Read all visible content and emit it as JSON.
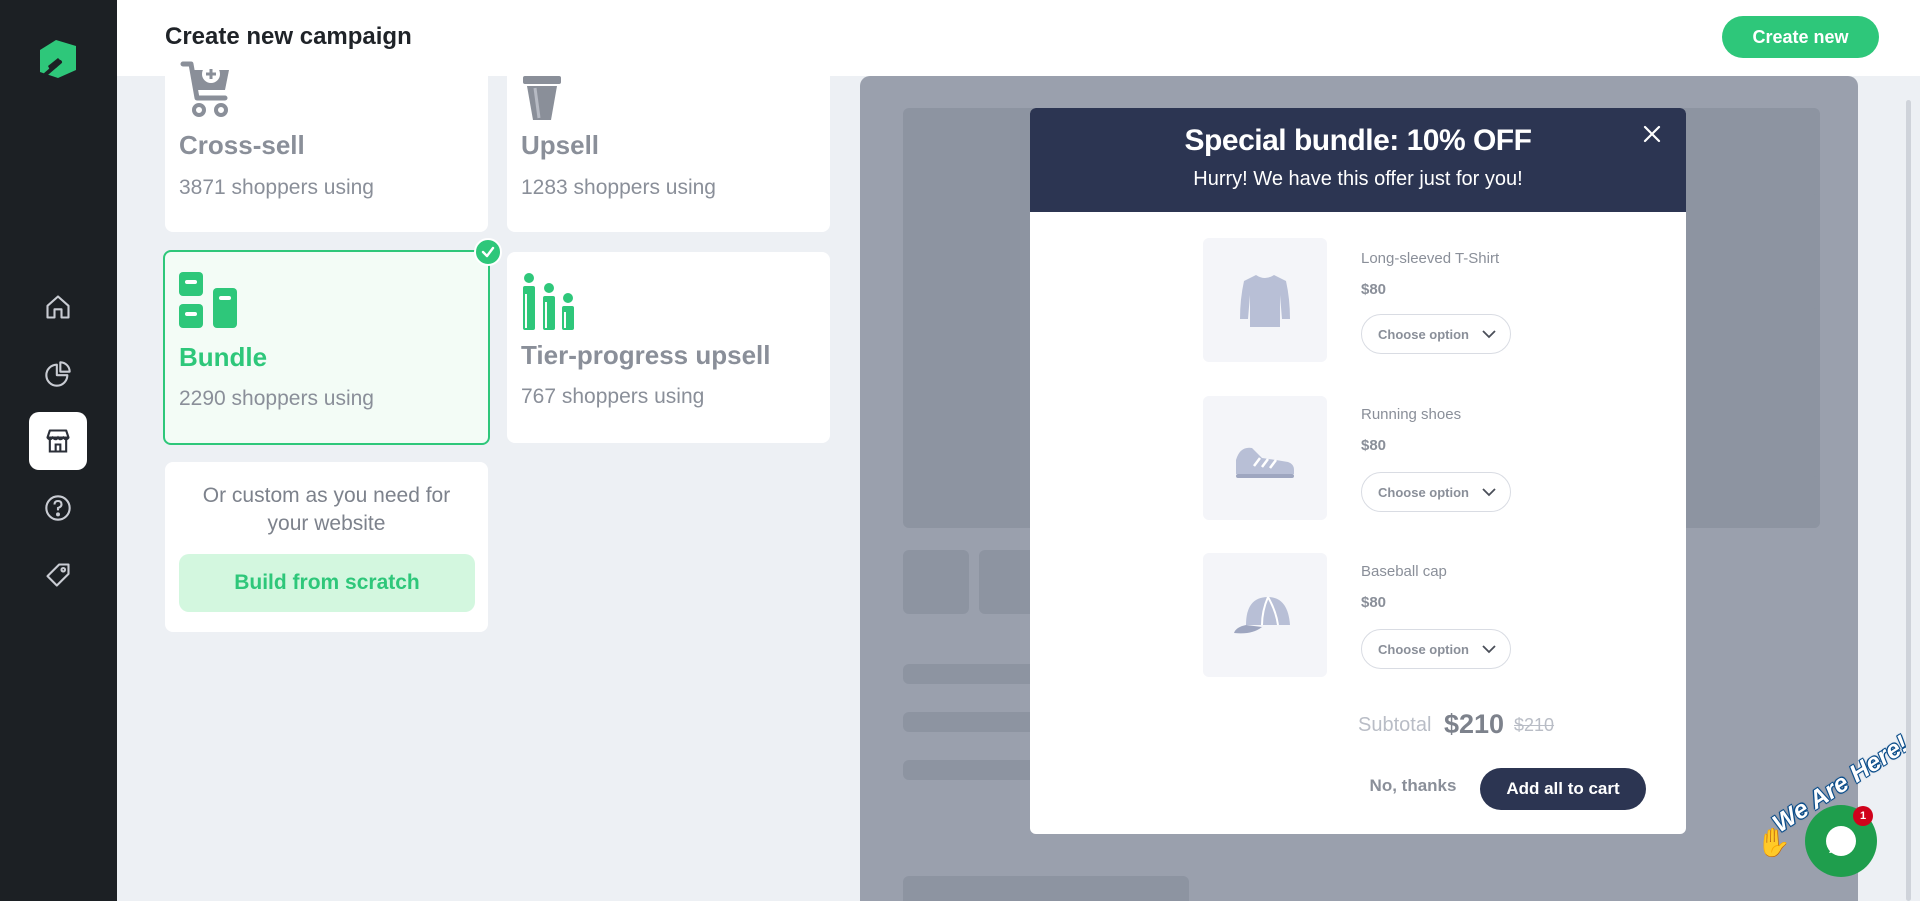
{
  "header": {
    "title": "Create new campaign",
    "create_label": "Create new"
  },
  "sidebar": {
    "items": [
      {
        "icon": "home-icon"
      },
      {
        "icon": "analytics-icon"
      },
      {
        "icon": "store-icon",
        "active": true
      },
      {
        "icon": "help-icon"
      },
      {
        "icon": "tag-icon"
      }
    ]
  },
  "campaigns": {
    "cross_sell": {
      "title": "Cross-sell",
      "sub": "3871 shoppers using"
    },
    "upsell": {
      "title": "Upsell",
      "sub": "1283 shoppers using"
    },
    "bundle": {
      "title": "Bundle",
      "sub": "2290 shoppers using",
      "selected": true
    },
    "tier": {
      "title": "Tier-progress upsell",
      "sub": "767 shoppers using"
    },
    "custom": {
      "text": "Or custom as you need for your website",
      "button": "Build from scratch"
    }
  },
  "modal": {
    "title": "Special bundle: 10% OFF",
    "subtitle": "Hurry! We have this offer just for you!",
    "products": [
      {
        "name": "Long-sleeved T-Shirt",
        "price": "$80",
        "option": "Choose option",
        "icon": "shirt-icon"
      },
      {
        "name": "Running shoes",
        "price": "$80",
        "option": "Choose option",
        "icon": "shoe-icon"
      },
      {
        "name": "Baseball cap",
        "price": "$80",
        "option": "Choose option",
        "icon": "cap-icon"
      }
    ],
    "subtotal_label": "Subtotal",
    "subtotal": "$210",
    "subtotal_old": "$210",
    "no_thanks": "No, thanks",
    "add_all": "Add all to cart"
  },
  "chat": {
    "tagline": "We Are Here!",
    "badge": "1"
  },
  "colors": {
    "accent": "#2ec77a",
    "navy": "#2c3552",
    "sidebar": "#1c2024"
  }
}
